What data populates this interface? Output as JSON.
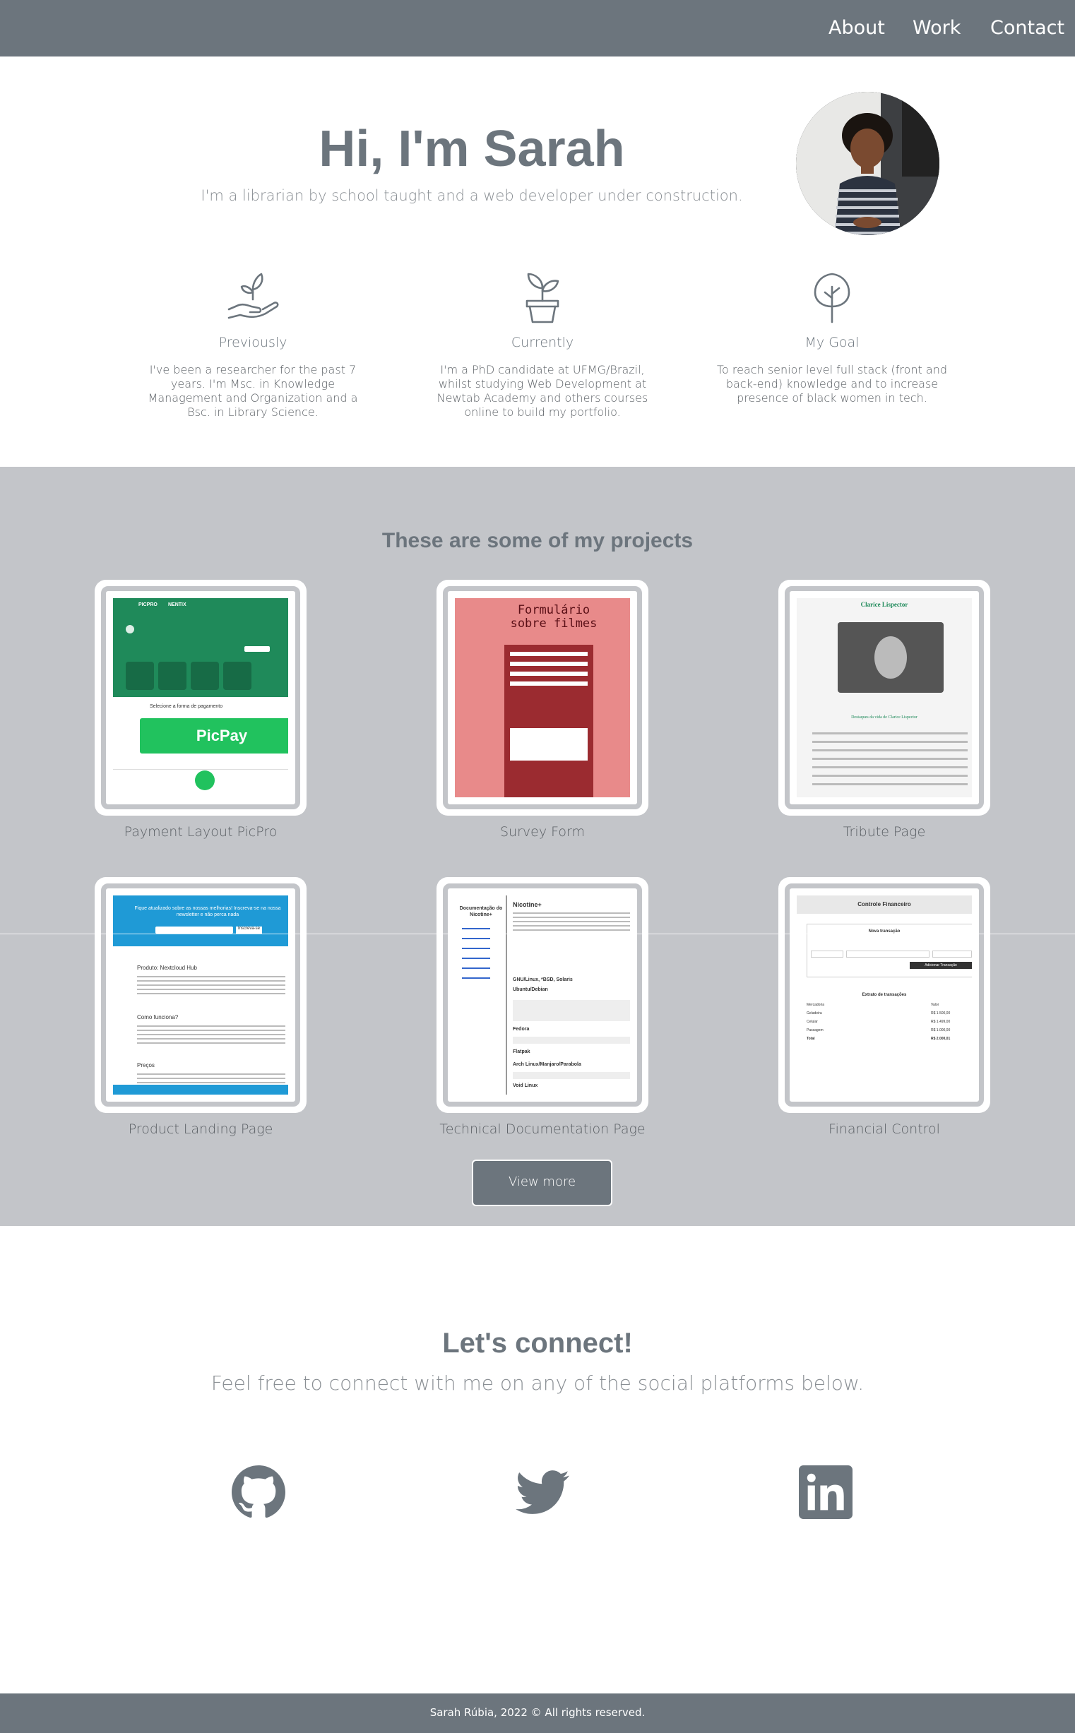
{
  "nav": {
    "about": "About",
    "work": "Work",
    "contact": "Contact"
  },
  "hero": {
    "title": "Hi, I'm Sarah",
    "subtitle": "I'm a librarian by school taught and a web developer under construction."
  },
  "info": [
    {
      "icon": "plant-in-hand-icon",
      "title": "Previously",
      "text": "I've been a researcher for the past 7 years. I'm Msc. in Knowledge Management and Organization and a Bsc. in Library Science."
    },
    {
      "icon": "potted-plant-icon",
      "title": "Currently",
      "text": "I'm a PhD candidate at UFMG/Brazil, whilst studying Web Development at Newtab Academy and others courses online to build my portfolio."
    },
    {
      "icon": "tree-icon",
      "title": "My Goal",
      "text": "To reach senior level full stack (front and back-end) knowledge and to increase presence of black women in tech."
    }
  ],
  "projects": {
    "title": "These are some of my projects",
    "items": [
      {
        "label": "Payment Layout PicPro"
      },
      {
        "label": "Survey Form"
      },
      {
        "label": "Tribute Page"
      },
      {
        "label": "Product Landing Page"
      },
      {
        "label": "Technical Documentation Page"
      },
      {
        "label": "Financial Control"
      }
    ],
    "view_more": "View more"
  },
  "thumbs": {
    "picpay_logo": "PicPay",
    "picpay_brand": "PICPRO",
    "picpay_brand2": "NENTIX",
    "picpay_choose": "Selecione a forma de pagamento",
    "survey_title": "Formulário sobre filmes",
    "tribute_title": "Clarice Lispector",
    "tribute_sub": "Destaques da vida de Clarice Lispector",
    "landing_banner": "Fique atualizado sobre as nossas melhorias! Inscreva-se na nossa newsletter e não perca nada",
    "landing_button": "Inscreva-se",
    "landing_h1": "Produto: Nextcloud Hub",
    "landing_h2": "Como funciona?",
    "landing_h3": "Preços",
    "doc_sidebar_title": "Documentação do Nicotine+",
    "doc_title": "Nicotine+",
    "doc_h2": "GNU/Linux, *BSD, Solaris",
    "doc_h3": "Ubuntu/Debian",
    "doc_h4": "Fedora",
    "doc_h5": "Flatpak",
    "doc_h6": "Arch Linux/Manjaro/Parabola",
    "doc_h7": "Void Linux",
    "fin_title": "Controle Financeiro",
    "fin_new": "Nova transação",
    "fin_button": "Adicionar Transação",
    "fin_statement": "Extrato de transações",
    "fin_rows": [
      {
        "name": "Mercadoria",
        "value": "Valor"
      },
      {
        "name": "Geladeira",
        "value": "R$ 1.500,00"
      },
      {
        "name": "Celular",
        "value": "R$ 1.499,00"
      },
      {
        "name": "Passagem",
        "value": "R$ 1.000,00"
      },
      {
        "name": "Total",
        "value": "R$ 2.000,01"
      }
    ]
  },
  "connect": {
    "title": "Let's connect!",
    "subtitle": "Feel free to connect with me on any of the social platforms below."
  },
  "social": [
    {
      "icon": "github-icon"
    },
    {
      "icon": "twitter-icon"
    },
    {
      "icon": "linkedin-icon"
    }
  ],
  "footer": {
    "text": "Sarah Rúbia, 2022 © All rights reserved."
  },
  "colors": {
    "primary": "#6c757d",
    "section_bg": "#c3c5c9",
    "white": "#ffffff"
  }
}
